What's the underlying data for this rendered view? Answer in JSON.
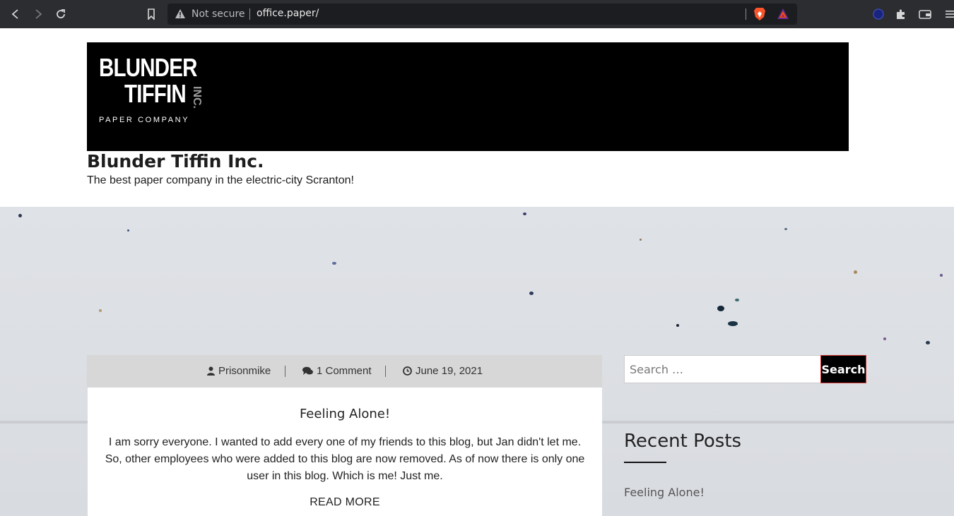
{
  "browser": {
    "security_label": "Not secure",
    "url": "office.paper/"
  },
  "header": {
    "logo": {
      "line1": "BLUNDER",
      "line2": "TIFFIN",
      "inc": "INC.",
      "tagline": "PAPER COMPANY"
    },
    "site_title": "Blunder Tiffin Inc.",
    "site_description": "The best paper company in the electric-city Scranton!"
  },
  "post": {
    "author": "Prisonmike",
    "comments": "1 Comment",
    "date": "June 19, 2021",
    "title": "Feeling Alone!",
    "excerpt": "I am sorry everyone. I wanted to add every one of my friends to this blog, but Jan didn't let me. So, other employees who were added to this blog are now removed. As of now there is only one user in this blog. Which is me! Just me.",
    "read_more": "READ MORE"
  },
  "sidebar": {
    "search_placeholder": "Search …",
    "search_button": "Search",
    "recent_posts_title": "Recent Posts",
    "recent_posts": [
      "Feeling Alone!"
    ]
  },
  "colors": {
    "chrome_bg": "#2b2d31",
    "banner_bg": "#000000",
    "meta_bg": "#d7d7d7",
    "search_button_border": "#d0312d"
  }
}
